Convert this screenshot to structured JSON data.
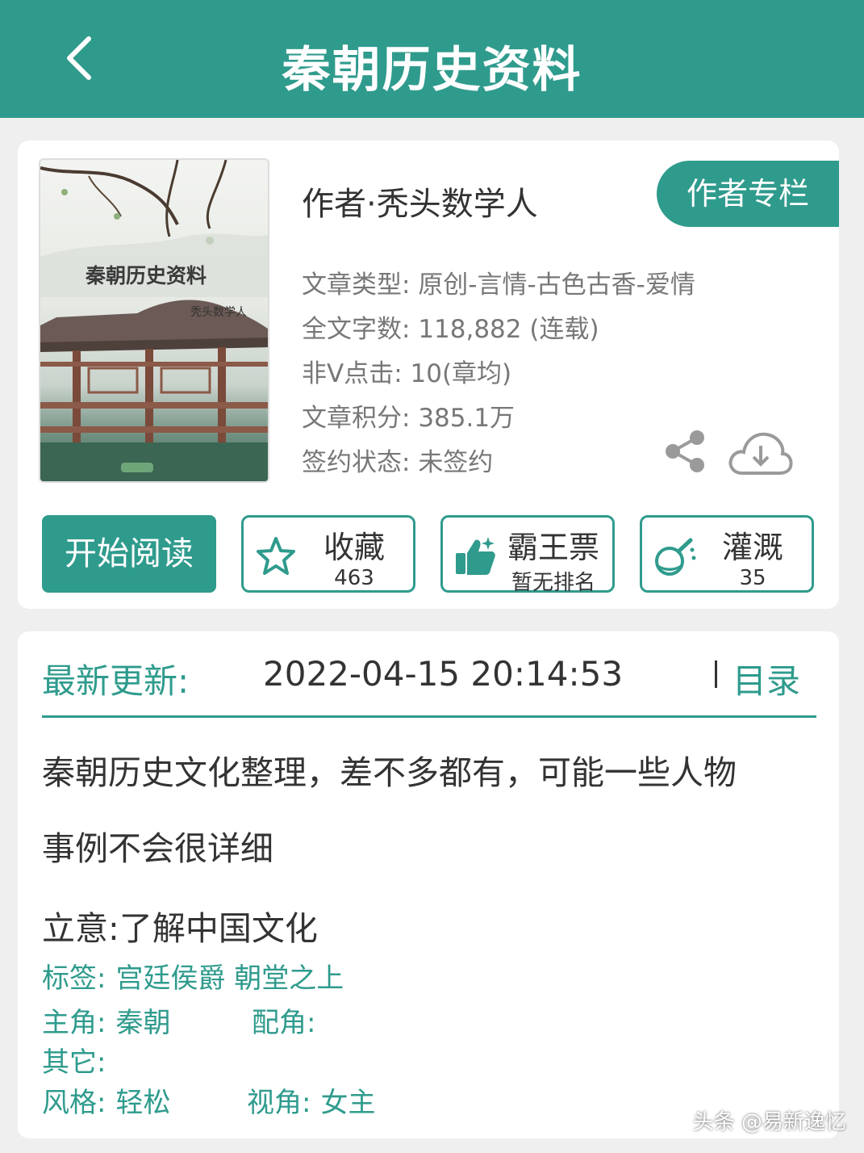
{
  "header": {
    "title": "秦朝历史资料",
    "back_icon": "chevron-left-icon"
  },
  "book": {
    "cover_title": "秦朝历史资料",
    "cover_author": "秃头数学人",
    "author_line": "作者·秃头数学人",
    "author_column_label": "作者专栏",
    "info": [
      {
        "label": "文章类型:",
        "value": "原创-言情-古色古香-爱情"
      },
      {
        "label": "全文字数:",
        "value": "118,882 (连载)"
      },
      {
        "label": "非V点击:",
        "value": "10(章均)"
      },
      {
        "label": "文章积分:",
        "value": "385.1万"
      },
      {
        "label": "签约状态:",
        "value": " 未签约"
      }
    ]
  },
  "actions": {
    "read_label": "开始阅读",
    "favorite": {
      "label": "收藏",
      "count": "463",
      "icon": "star-icon"
    },
    "vote": {
      "label": "霸王票",
      "sub": "暂无排名",
      "icon": "thumbs-up-icon"
    },
    "water": {
      "label": "灌溉",
      "count": "35",
      "icon": "flask-icon"
    }
  },
  "update": {
    "label": "最新更新:",
    "time": "2022-04-15 20:14:53",
    "toc_label": "目录"
  },
  "summary": {
    "intro_line1": "秦朝历史文化整理，差不多都有，可能一些人物",
    "intro_line2": "事例不会很详细",
    "theme": "立意:了解中国文化"
  },
  "meta": {
    "tags_label": "标签:",
    "tags": "宫廷侯爵  朝堂之上",
    "lead_label": "主角:",
    "lead": "秦朝",
    "support_label": "配角:",
    "support": "",
    "other_label": "其它:",
    "other": "",
    "style_label": "风格:",
    "style": "轻松",
    "pov_label": "视角:",
    "pov": "女主"
  },
  "watermark": "头条 @易新逸忆",
  "colors": {
    "accent": "#2f9b8d",
    "background": "#efefef"
  }
}
